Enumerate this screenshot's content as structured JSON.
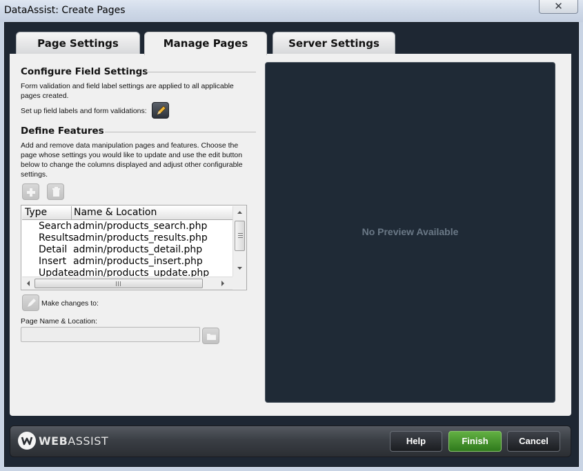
{
  "window": {
    "title": "DataAssist: Create Pages",
    "close_glyph": "✕"
  },
  "tabs": [
    {
      "label": "Page Settings",
      "active": false
    },
    {
      "label": "Manage Pages",
      "active": true
    },
    {
      "label": "Server Settings",
      "active": false
    }
  ],
  "configure": {
    "title": "Configure Field Settings",
    "desc_line1": "Form validation and field label settings are applied to all applicable",
    "desc_line2": "pages created.",
    "setup_label": "Set up field labels and form validations:"
  },
  "features": {
    "title": "Define Features",
    "desc_line1": "Add and remove data manipulation pages and features. Choose the",
    "desc_line2": "page whose settings you would like to update and use the edit button",
    "desc_line3": "below to change the columns displayed and adjust other configurable",
    "desc_line4": "settings."
  },
  "pages_list": {
    "columns": [
      "Type",
      "Name & Location"
    ],
    "rows": [
      {
        "type": "Search",
        "name": "admin/products_search.php"
      },
      {
        "type": "Results",
        "name": "admin/products_results.php"
      },
      {
        "type": "Detail",
        "name": "admin/products_detail.php"
      },
      {
        "type": "Insert",
        "name": "admin/products_insert.php"
      },
      {
        "type": "Update",
        "name": "admin/products_update.php"
      }
    ]
  },
  "edit": {
    "make_changes_label": "Make changes to:"
  },
  "page_name": {
    "label": "Page Name & Location:",
    "value": ""
  },
  "preview": {
    "text": "No Preview Available"
  },
  "footer": {
    "brand_bold": "WEB",
    "brand_rest": "ASSIST",
    "help_label": "Help",
    "finish_label": "Finish",
    "cancel_label": "Cancel"
  }
}
